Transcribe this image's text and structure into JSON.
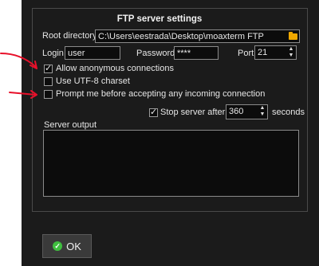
{
  "dialog": {
    "title": "FTP server settings",
    "root_directory": {
      "label": "Root directory",
      "value": "C:\\Users\\eestrada\\Desktop\\moaxterm FTP"
    },
    "login": {
      "label": "Login",
      "value": "user"
    },
    "password": {
      "label": "Password",
      "value": "****"
    },
    "port": {
      "label": "Port",
      "value": "21"
    },
    "options": [
      {
        "label": "Allow anonymous connections",
        "checked": true
      },
      {
        "label": "Use UTF-8 charset",
        "checked": false
      },
      {
        "label": "Prompt me before accepting any incoming connection",
        "checked": false
      }
    ],
    "stop_server": {
      "label": "Stop server after",
      "checked": true,
      "value": "360",
      "unit": "seconds"
    },
    "server_output": {
      "label": "Server output"
    },
    "ok_button": {
      "label": "OK"
    }
  },
  "annotations": {
    "arrow_color": "#e8102a"
  },
  "icons": [
    "folder-icon",
    "check-icon",
    "spinner-up-icon",
    "spinner-down-icon",
    "ok-check-icon",
    "red-arrow-icon"
  ]
}
